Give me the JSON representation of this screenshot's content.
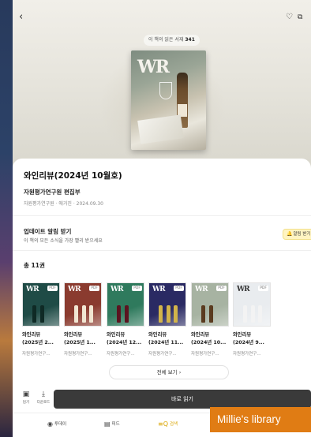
{
  "hero": {
    "readers_prefix": "이 책의 읽은 서재",
    "readers_count": "341",
    "back_icon": "chevron-left-icon",
    "actions": [
      "heart-icon",
      "share-icon"
    ],
    "cover_logo": "WR"
  },
  "book": {
    "title": "와인리뷰(2024년 10월호)",
    "publisher": "자원평가연구원 편집부",
    "meta": "자원평가연구원 · 애거진 · 2024.09.30"
  },
  "alert": {
    "title": "업데이트 알림 받기",
    "description": "이 책의 모든 소식을 가장 빨리 받으세요",
    "button_label": "알림 받기"
  },
  "series": {
    "total_label": "총 11권",
    "items": [
      {
        "line1": "와인리뷰",
        "line2": "(2025년 2...",
        "author": "자원평가연구...",
        "tag": "PDF",
        "color": "#1f4b46",
        "bottle": "#0f2a25"
      },
      {
        "line1": "와인리뷰",
        "line2": "(2025년 1...",
        "author": "자원평가연구...",
        "tag": "PDF",
        "color": "#8a3b2f",
        "bottle": "#f1e6d2"
      },
      {
        "line1": "와인리뷰",
        "line2": "(2024년 12...",
        "author": "자원평가연구...",
        "tag": "PDF",
        "color": "#2f7a5d",
        "bottle": "#5b1420"
      },
      {
        "line1": "와인리뷰",
        "line2": "(2024년 11...",
        "author": "자원평가연구...",
        "tag": "PDF",
        "color": "#2a2a63",
        "bottle": "#d2b44a"
      },
      {
        "line1": "와인리뷰",
        "line2": "(2024년 10...",
        "author": "자원평가연구...",
        "tag": "PDF",
        "color": "#a7b3a2",
        "bottle": "#5a3b1f"
      },
      {
        "line1": "와인리뷰",
        "line2": "(2024년 9...",
        "author": "자원평가연구...",
        "tag": "PDF",
        "color": "#e9ecef",
        "bottle": "#f3f3f3"
      }
    ],
    "view_all_label": "전체 보기 ›"
  },
  "actions": {
    "items": [
      {
        "icon": "bookshelf-icon",
        "label": "담기"
      },
      {
        "icon": "download-icon",
        "label": "다운로드"
      }
    ],
    "read_label": "바로 읽기"
  },
  "tabbar": {
    "items": [
      {
        "icon": "today-icon",
        "label": "투데이",
        "active": false
      },
      {
        "icon": "feed-icon",
        "label": "피드",
        "active": false
      },
      {
        "icon": "search-icon",
        "label": "검색",
        "active": true
      }
    ]
  },
  "overlay": {
    "badge": "Millie's library"
  },
  "colors": {
    "accent": "#d9a400",
    "read_button": "#3a3a3a",
    "badge": "#e07c14"
  }
}
